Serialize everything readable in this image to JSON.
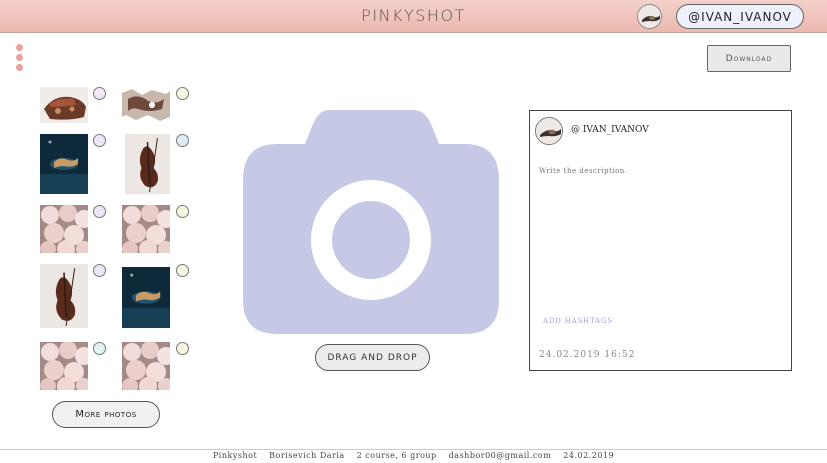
{
  "header": {
    "title": "PINKYSHOT",
    "username": "@IVAN_IVANOV"
  },
  "toolbar": {
    "download_label": "Download"
  },
  "gallery": {
    "thumbnails": [
      {
        "image": "cake-slice",
        "radio_color": "#f3e6f7"
      },
      {
        "image": "torn-paper",
        "radio_color": "#f7f7e0"
      },
      {
        "image": "violin-dark-water",
        "radio_color": "#efe6f7"
      },
      {
        "image": "violin-bow",
        "radio_color": "#dfeaf9"
      },
      {
        "image": "peonies",
        "radio_color": "#efe6f7"
      },
      {
        "image": "peonies",
        "radio_color": "#f7f7e0"
      },
      {
        "image": "violin-bow",
        "radio_color": "#ece6f7"
      },
      {
        "image": "violin-dark-water",
        "radio_color": "#f7f7e0"
      },
      {
        "image": "peonies",
        "radio_color": "#e0f4f4"
      },
      {
        "image": "peonies",
        "radio_color": "#f7f7e0"
      }
    ],
    "more_label": "More photos"
  },
  "upload": {
    "icon": "camera-icon",
    "dnd_label": "DRAG AND DROP",
    "camera_color": "#c5c9e6"
  },
  "post": {
    "username": "@ IVAN_IVANOV",
    "description_placeholder": "Write the description.",
    "hashtags_label": "ADD HASHTAGS",
    "datetime": "24.02.2019 16:52"
  },
  "footer": {
    "items": [
      "Pinkyshot",
      "Borisevich Daria",
      "2 course,  6 group",
      "dashbor00@gmail.com",
      "24.02.2019"
    ]
  },
  "colors": {
    "header_bg": "#ecb9b0",
    "menu_dots": "#eaa1a0",
    "pill_bg": "#eef0fb"
  }
}
